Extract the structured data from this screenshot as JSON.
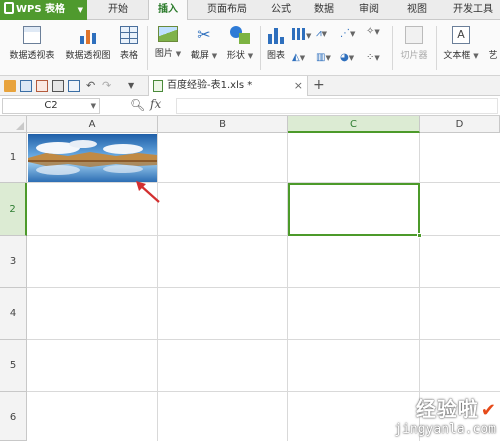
{
  "app": {
    "name": "WPS 表格"
  },
  "menu": {
    "tabs": [
      {
        "label": "开始"
      },
      {
        "label": "插入"
      },
      {
        "label": "页面布局"
      },
      {
        "label": "公式"
      },
      {
        "label": "数据"
      },
      {
        "label": "审阅"
      },
      {
        "label": "视图"
      },
      {
        "label": "开发工具"
      }
    ],
    "active_tab": "插入"
  },
  "ribbon": {
    "pivot_table": "数据透视表",
    "pivot_chart": "数据透视图",
    "table": "表格",
    "picture": "图片",
    "screenshot": "截屏",
    "shape": "形状",
    "chart": "图表",
    "slicer": "切片器",
    "textbox": "文本框",
    "art": "艺"
  },
  "document": {
    "tab_label": "百度经验-表1.xls *"
  },
  "formula_bar": {
    "name_box": "C2",
    "fx": "fx",
    "formula": ""
  },
  "grid": {
    "columns": [
      "A",
      "B",
      "C",
      "D"
    ],
    "rows": [
      "1",
      "2",
      "3",
      "4",
      "5",
      "6"
    ],
    "selected_cell": "C2",
    "selected_column": "C",
    "selected_row": "2"
  },
  "watermark": {
    "title": "经验啦",
    "url": "jingyanla.com"
  },
  "colors": {
    "accent": "#4c9a2a",
    "arrow": "#d32f2f"
  }
}
